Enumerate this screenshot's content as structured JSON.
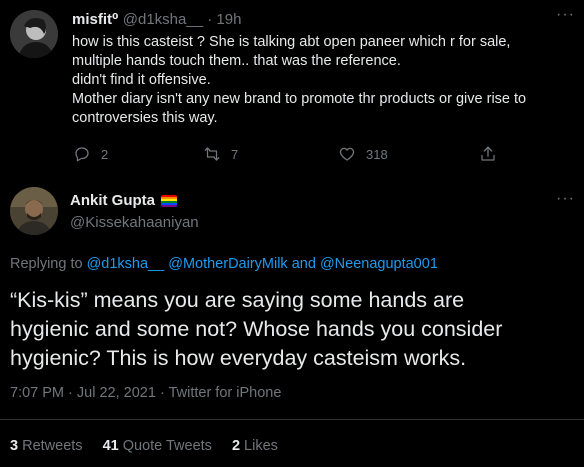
{
  "reply_tweet": {
    "display_name": "misfit",
    "name_glyph": "⁰",
    "handle": "@d1ksha__",
    "separator": "·",
    "time": "19h",
    "more": "···",
    "lines": [
      "how is this casteist ? She is talking abt open paneer which r for sale,",
      "multiple hands touch them.. that was the reference.",
      "didn't find it offensive.",
      "Mother diary isn't any new brand to promote thr products or give rise to",
      "controversies this way."
    ],
    "actions": {
      "replies": "2",
      "retweets": "7",
      "likes": "318"
    }
  },
  "main_tweet": {
    "display_name": "Ankit Gupta",
    "handle": "@Kissekahaaniyan",
    "more": "···",
    "replying_prefix": "Replying to",
    "replying_to": [
      "@d1ksha__",
      "@MotherDairyMilk"
    ],
    "replying_and": "and",
    "replying_last": "@Neenagupta001",
    "text_lines": [
      "“Kis-kis” means you are saying some hands are",
      "hygienic and some not? Whose hands you consider",
      "hygienic? This is how everyday casteism works."
    ],
    "time": "7:07 PM",
    "date": "Jul 22, 2021",
    "source": "Twitter for iPhone",
    "dot": "·"
  },
  "stats": {
    "retweets_count": "3",
    "retweets_label": "Retweets",
    "quotes_count": "41",
    "quotes_label": "Quote Tweets",
    "likes_count": "2",
    "likes_label": "Likes"
  },
  "colors": {
    "background": "#000000",
    "text": "#e7e9ea",
    "muted": "#71767b",
    "link": "#1d9bf0",
    "divider": "#2f3336"
  },
  "icons": [
    "reply-icon",
    "retweet-icon",
    "like-icon",
    "share-icon",
    "pride-flag-icon",
    "more-icon"
  ]
}
